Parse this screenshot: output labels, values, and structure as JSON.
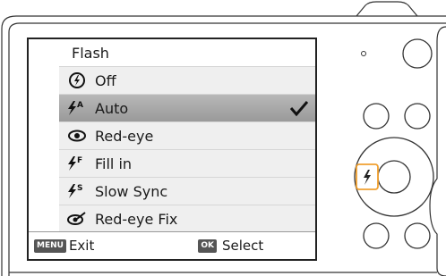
{
  "menu": {
    "title": "Flash",
    "items": [
      {
        "label": "Off",
        "icon": "flash-off-icon",
        "selected": false
      },
      {
        "label": "Auto",
        "icon": "flash-auto-icon",
        "selected": true
      },
      {
        "label": "Red-eye",
        "icon": "red-eye-icon",
        "selected": false
      },
      {
        "label": "Fill in",
        "icon": "flash-fill-in-icon",
        "selected": false
      },
      {
        "label": "Slow Sync",
        "icon": "flash-slow-sync-icon",
        "selected": false
      },
      {
        "label": "Red-eye Fix",
        "icon": "red-eye-fix-icon",
        "selected": false
      }
    ]
  },
  "footer": {
    "menu_key": "MENU",
    "exit_label": "Exit",
    "ok_key": "OK",
    "select_label": "Select"
  },
  "colors": {
    "highlight_button": "#f0a030",
    "selected_row": "#a8a8a8"
  }
}
